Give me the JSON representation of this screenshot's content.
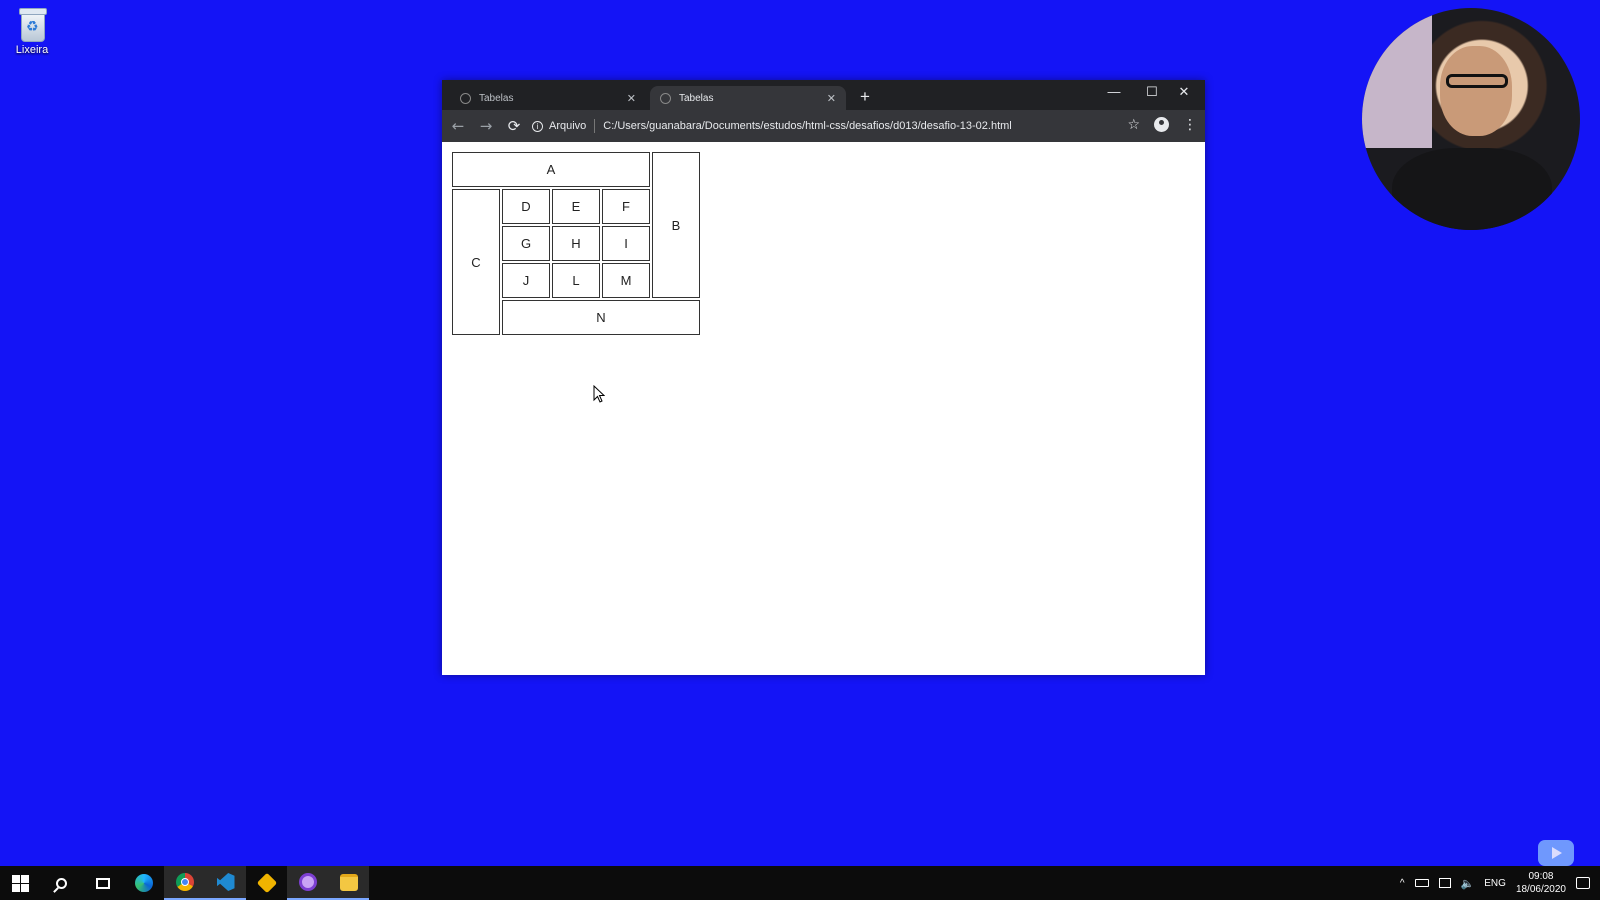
{
  "desktop": {
    "recycle_bin_label": "Lixeira"
  },
  "browser": {
    "tabs": [
      {
        "title": "Tabelas",
        "close": "✕"
      },
      {
        "title": "Tabelas",
        "close": "✕"
      }
    ],
    "new_tab": "+",
    "window_controls": {
      "minimize": "—",
      "maximize": "☐",
      "close": "✕"
    },
    "nav": {
      "back": "←",
      "forward": "→",
      "reload": "⟳"
    },
    "omnibox": {
      "info": "i",
      "scheme_label": "Arquivo",
      "url": "C:/Users/guanabara/Documents/estudos/html-css/desafios/d013/desafio-13-02.html"
    },
    "star": "☆",
    "menu": "⋮"
  },
  "table": {
    "cells": {
      "a": "A",
      "b": "B",
      "c": "C",
      "d": "D",
      "e": "E",
      "f": "F",
      "g": "G",
      "h": "H",
      "i": "I",
      "j": "J",
      "l": "L",
      "m": "M",
      "n": "N"
    }
  },
  "taskbar": {
    "icons": [
      "windows-start-icon",
      "search-icon",
      "task-view-icon",
      "edge-icon",
      "chrome-icon",
      "vscode-icon",
      "git-icon",
      "app-icon",
      "file-explorer-icon"
    ],
    "tray": {
      "chevron": "^",
      "language": "ENG",
      "time": "09:08",
      "date": "18/06/2020"
    }
  }
}
